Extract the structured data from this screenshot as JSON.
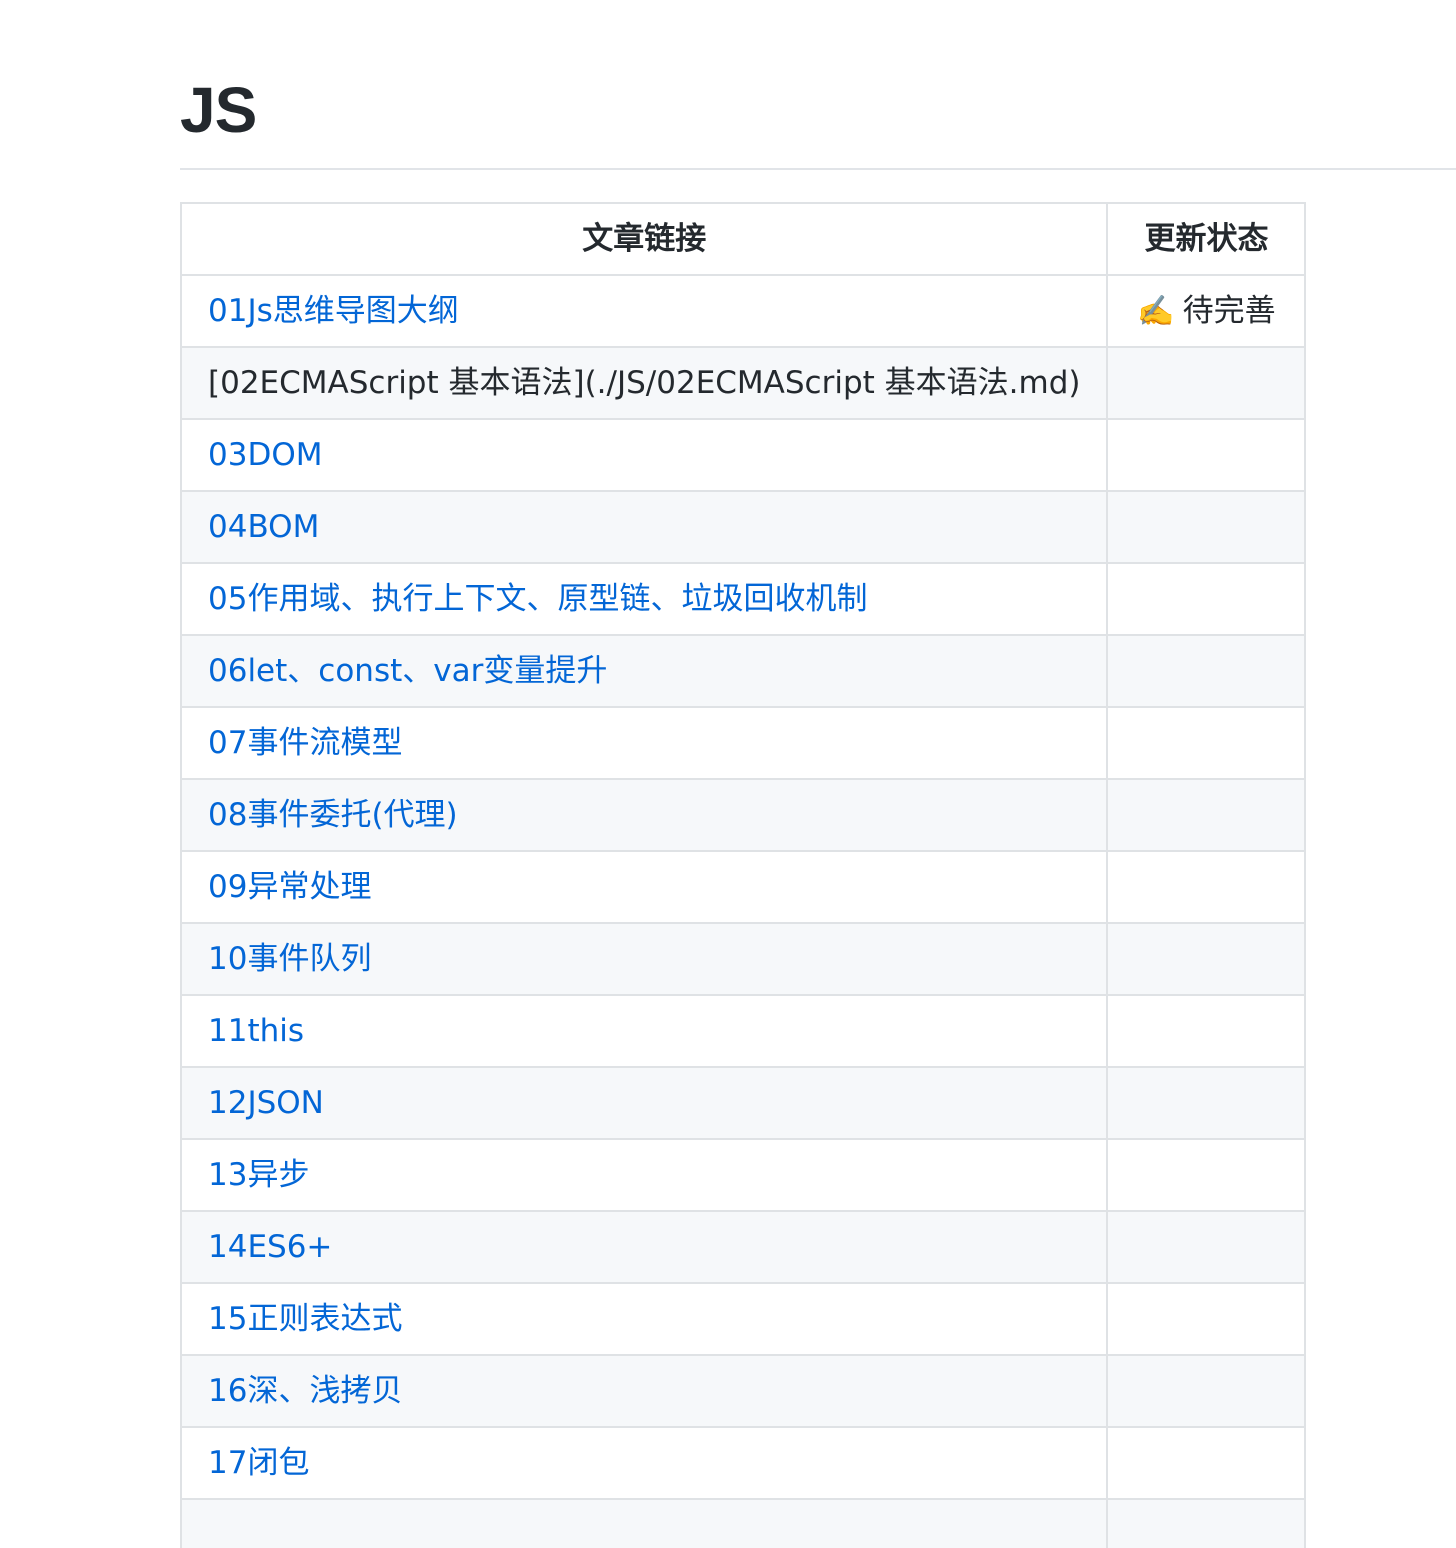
{
  "page": {
    "title": "JS"
  },
  "table": {
    "headers": {
      "link": "文章链接",
      "status": "更新状态"
    },
    "rows": [
      {
        "text": "01Js思维导图大纲",
        "is_link": true,
        "status_icon": "✍️",
        "status_text": "待完善"
      },
      {
        "text": "[02ECMAScript 基本语法](./JS/02ECMAScript 基本语法.md)",
        "is_link": false,
        "status_icon": "",
        "status_text": ""
      },
      {
        "text": "03DOM",
        "is_link": true,
        "status_icon": "",
        "status_text": ""
      },
      {
        "text": "04BOM",
        "is_link": true,
        "status_icon": "",
        "status_text": ""
      },
      {
        "text": "05作用域、执行上下文、原型链、垃圾回收机制",
        "is_link": true,
        "status_icon": "",
        "status_text": ""
      },
      {
        "text": "06let、const、var变量提升",
        "is_link": true,
        "status_icon": "",
        "status_text": ""
      },
      {
        "text": "07事件流模型",
        "is_link": true,
        "status_icon": "",
        "status_text": ""
      },
      {
        "text": "08事件委托(代理)",
        "is_link": true,
        "status_icon": "",
        "status_text": ""
      },
      {
        "text": "09异常处理",
        "is_link": true,
        "status_icon": "",
        "status_text": ""
      },
      {
        "text": "10事件队列",
        "is_link": true,
        "status_icon": "",
        "status_text": ""
      },
      {
        "text": "11this",
        "is_link": true,
        "status_icon": "",
        "status_text": ""
      },
      {
        "text": "12JSON",
        "is_link": true,
        "status_icon": "",
        "status_text": ""
      },
      {
        "text": "13异步",
        "is_link": true,
        "status_icon": "",
        "status_text": ""
      },
      {
        "text": "14ES6+",
        "is_link": true,
        "status_icon": "",
        "status_text": ""
      },
      {
        "text": "15正则表达式",
        "is_link": true,
        "status_icon": "",
        "status_text": ""
      },
      {
        "text": "16深、浅拷贝",
        "is_link": true,
        "status_icon": "",
        "status_text": ""
      },
      {
        "text": "17闭包",
        "is_link": true,
        "status_icon": "",
        "status_text": ""
      },
      {
        "text": "",
        "is_link": true,
        "status_icon": "",
        "status_text": ""
      }
    ]
  },
  "colors": {
    "link": "#0366d6",
    "text": "#24292e",
    "border": "#dfe2e5",
    "stripe": "#f6f8fa"
  }
}
